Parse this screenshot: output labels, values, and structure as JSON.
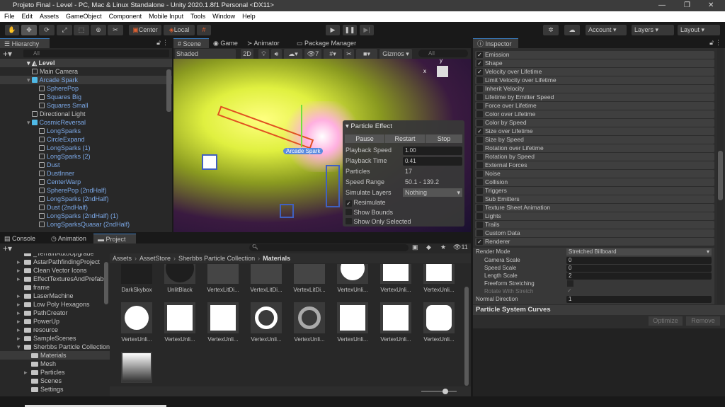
{
  "window": {
    "title": "Projeto Final - Level - PC, Mac & Linux Standalone - Unity 2020.1.8f1 Personal <DX11>",
    "minimize": "—",
    "restore": "❐",
    "close": "✕"
  },
  "menu": [
    "File",
    "Edit",
    "Assets",
    "GameObject",
    "Component",
    "Mobile Input",
    "Tools",
    "Window",
    "Help"
  ],
  "toolbar": {
    "center": "Center",
    "local": "Local",
    "account": "Account",
    "layers": "Layers",
    "layout": "Layout"
  },
  "hierarchy": {
    "title": "Hierarchy",
    "search_placeholder": "All",
    "scene": "Level",
    "items": [
      {
        "label": "Main Camera",
        "depth": 1,
        "prefab": false
      },
      {
        "label": "Arcade Spark",
        "depth": 1,
        "prefab": true,
        "selected": true
      },
      {
        "label": "SpherePop",
        "depth": 2,
        "prefab": true
      },
      {
        "label": "Squares Big",
        "depth": 2,
        "prefab": true
      },
      {
        "label": "Squares Small",
        "depth": 2,
        "prefab": true
      },
      {
        "label": "Directional Light",
        "depth": 1,
        "prefab": false
      },
      {
        "label": "CosmicReversal",
        "depth": 1,
        "prefab": true
      },
      {
        "label": "LongSparks",
        "depth": 2,
        "prefab": true
      },
      {
        "label": "CircleExpand",
        "depth": 2,
        "prefab": true
      },
      {
        "label": "LongSparks (1)",
        "depth": 2,
        "prefab": true
      },
      {
        "label": "LongSparks (2)",
        "depth": 2,
        "prefab": true
      },
      {
        "label": "Dust",
        "depth": 2,
        "prefab": true
      },
      {
        "label": "DustInner",
        "depth": 2,
        "prefab": true
      },
      {
        "label": "CenterWarp",
        "depth": 2,
        "prefab": true
      },
      {
        "label": "SpherePop (2ndHalf)",
        "depth": 2,
        "prefab": true
      },
      {
        "label": "LongSparks (2ndHalf)",
        "depth": 2,
        "prefab": true
      },
      {
        "label": "Dust (2ndHalf)",
        "depth": 2,
        "prefab": true
      },
      {
        "label": "LongSparks (2ndHalf) (1)",
        "depth": 2,
        "prefab": true
      },
      {
        "label": "LongSparksQuasar (2ndHalf)",
        "depth": 2,
        "prefab": true
      }
    ]
  },
  "scene": {
    "tabs": [
      "Scene",
      "Game",
      "Animator",
      "Package Manager"
    ],
    "shading": "Shaded",
    "mode2d": "2D",
    "hidden_count": "7",
    "gizmos": "Gizmos",
    "search_placeholder": "All",
    "selection_label": "Arcade Spark",
    "axis_x": "x",
    "axis_y": "y",
    "particle_effect": {
      "title": "Particle Effect",
      "pause": "Pause",
      "restart": "Restart",
      "stop": "Stop",
      "playback_speed_label": "Playback Speed",
      "playback_speed": "1.00",
      "playback_time_label": "Playback Time",
      "playback_time": "0.41",
      "particles_label": "Particles",
      "particles": "17",
      "speed_range_label": "Speed Range",
      "speed_range": "50.1 - 139.2",
      "simulate_layers_label": "Simulate Layers",
      "simulate_layers": "Nothing",
      "resimulate": "Resimulate",
      "show_bounds": "Show Bounds",
      "show_only_selected": "Show Only Selected"
    }
  },
  "inspector": {
    "title": "Inspector",
    "modules": [
      {
        "label": "Emission",
        "on": true
      },
      {
        "label": "Shape",
        "on": true
      },
      {
        "label": "Velocity over Lifetime",
        "on": true
      },
      {
        "label": "Limit Velocity over Lifetime",
        "on": false
      },
      {
        "label": "Inherit Velocity",
        "on": false
      },
      {
        "label": "Lifetime by Emitter Speed",
        "on": false
      },
      {
        "label": "Force over Lifetime",
        "on": false
      },
      {
        "label": "Color over Lifetime",
        "on": false
      },
      {
        "label": "Color by Speed",
        "on": false
      },
      {
        "label": "Size over Lifetime",
        "on": true
      },
      {
        "label": "Size by Speed",
        "on": false
      },
      {
        "label": "Rotation over Lifetime",
        "on": false
      },
      {
        "label": "Rotation by Speed",
        "on": false
      },
      {
        "label": "External Forces",
        "on": false
      },
      {
        "label": "Noise",
        "on": false
      },
      {
        "label": "Collision",
        "on": false
      },
      {
        "label": "Triggers",
        "on": false
      },
      {
        "label": "Sub Emitters",
        "on": false
      },
      {
        "label": "Texture Sheet Animation",
        "on": false
      },
      {
        "label": "Lights",
        "on": false
      },
      {
        "label": "Trails",
        "on": false
      },
      {
        "label": "Custom Data",
        "on": false
      },
      {
        "label": "Renderer",
        "on": true
      }
    ],
    "renderer": {
      "render_mode_label": "Render Mode",
      "render_mode": "Stretched Billboard",
      "camera_scale_label": "Camera Scale",
      "camera_scale": "0",
      "speed_scale_label": "Speed Scale",
      "speed_scale": "0",
      "length_scale_label": "Length Scale",
      "length_scale": "2",
      "freeform_label": "Freeform Stretching",
      "rotate_label": "Rotate With Stretch",
      "normal_direction_label": "Normal Direction",
      "normal_direction": "1"
    },
    "curves_title": "Particle System Curves",
    "optimize": "Optimize",
    "remove": "Remove"
  },
  "bottom": {
    "tabs": [
      "Console",
      "Animation",
      "Project"
    ],
    "hidden_count": "11",
    "breadcrumb": [
      "Assets",
      "AssetStore",
      "Sherbbs Particle Collection",
      "Materials"
    ],
    "folders": [
      {
        "label": "_TerrainAutoUpgrade",
        "depth": 1,
        "arrow": false
      },
      {
        "label": "AstarPathfindingProject",
        "depth": 1,
        "arrow": true
      },
      {
        "label": "Clean Vector Icons",
        "depth": 1,
        "arrow": true
      },
      {
        "label": "EffectTexturesAndPrefabs",
        "depth": 1,
        "arrow": true
      },
      {
        "label": "frame",
        "depth": 1,
        "arrow": false
      },
      {
        "label": "LaserMachine",
        "depth": 1,
        "arrow": true
      },
      {
        "label": "Low Poly Hexagons",
        "depth": 1,
        "arrow": true
      },
      {
        "label": "PathCreator",
        "depth": 1,
        "arrow": true
      },
      {
        "label": "PowerUp",
        "depth": 1,
        "arrow": true
      },
      {
        "label": "resource",
        "depth": 1,
        "arrow": true
      },
      {
        "label": "SampleScenes",
        "depth": 1,
        "arrow": true
      },
      {
        "label": "Sherbbs Particle Collection",
        "depth": 1,
        "arrow": true,
        "open": true
      },
      {
        "label": "Materials",
        "depth": 2,
        "arrow": false,
        "selected": true
      },
      {
        "label": "Mesh",
        "depth": 2,
        "arrow": false
      },
      {
        "label": "Particles",
        "depth": 2,
        "arrow": true
      },
      {
        "label": "Scenes",
        "depth": 2,
        "arrow": false
      },
      {
        "label": "Settings",
        "depth": 2,
        "arrow": false
      }
    ],
    "assets": [
      {
        "label": "DarkSkybox",
        "shape": "dark"
      },
      {
        "label": "UnlitBlack",
        "shape": "blackcircle"
      },
      {
        "label": "VertexLitDi...",
        "shape": "grey"
      },
      {
        "label": "VertexLitDi...",
        "shape": "grey"
      },
      {
        "label": "VertexLitDi...",
        "shape": "grey"
      },
      {
        "label": "VertexUnli...",
        "shape": "circle"
      },
      {
        "label": "VertexUnli...",
        "shape": "square"
      },
      {
        "label": "VertexUnli...",
        "shape": "square"
      },
      {
        "label": "VertexUnli...",
        "shape": "circle"
      },
      {
        "label": "VertexUnli...",
        "shape": "square"
      },
      {
        "label": "VertexUnli...",
        "shape": "square"
      },
      {
        "label": "VertexUnli...",
        "shape": "ring"
      },
      {
        "label": "VertexUnli...",
        "shape": "greyring"
      },
      {
        "label": "VertexUnli...",
        "shape": "square"
      },
      {
        "label": "VertexUnli...",
        "shape": "square"
      },
      {
        "label": "VertexUnli...",
        "shape": "rounded"
      },
      {
        "label": "",
        "shape": "gradient"
      }
    ]
  }
}
